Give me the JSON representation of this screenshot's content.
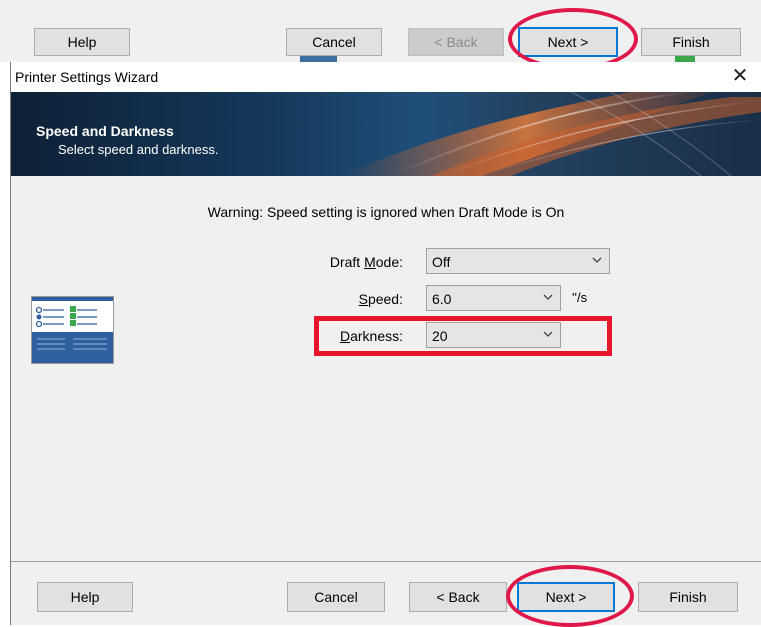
{
  "background_buttons": {
    "help": "Help",
    "cancel": "Cancel",
    "back": "< Back",
    "next": "Next >",
    "finish": "Finish"
  },
  "window": {
    "title": "Printer Settings Wizard",
    "close_glyph": "✕"
  },
  "banner": {
    "title": "Speed and Darkness",
    "subtitle": "Select speed and darkness."
  },
  "warning": "Warning: Speed setting is ignored when Draft Mode is On",
  "fields": {
    "draft_mode": {
      "label_pre": "Draft ",
      "label_mnemonic": "M",
      "label_post": "ode:",
      "value": "Off"
    },
    "speed": {
      "label_mnemonic": "S",
      "label_post": "peed:",
      "value": "6.0",
      "unit": "''/s"
    },
    "darkness": {
      "label_mnemonic": "D",
      "label_post": "arkness:",
      "value": "20"
    }
  },
  "buttons": {
    "help": "Help",
    "cancel": "Cancel",
    "back": "< Back",
    "next": "Next >",
    "finish": "Finish"
  },
  "colors": {
    "annotation_red": "#e8142c",
    "focus_blue": "#0078d7",
    "icon_blue": "#2f5f9e",
    "icon_green": "#3aa84a"
  },
  "icons": {
    "wizard_page": "settings-checklist-icon",
    "dropdown": "chevron-down-icon",
    "close": "close-icon"
  }
}
